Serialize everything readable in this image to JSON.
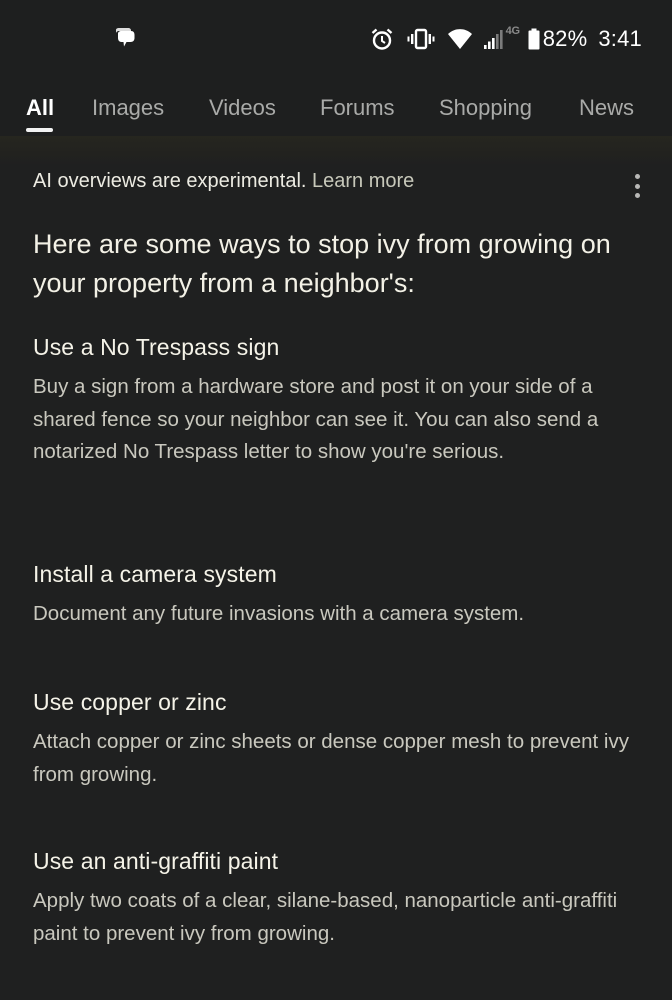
{
  "status_bar": {
    "left_icons": [
      "messages-icon"
    ],
    "right_icons": [
      "alarm-icon",
      "vibrate-icon",
      "wifi-icon",
      "signal-icon"
    ],
    "network_type": "4G",
    "battery_percent": "82%",
    "time": "3:41"
  },
  "tabs": {
    "items": [
      {
        "label": "All",
        "active": true
      },
      {
        "label": "Images",
        "active": false
      },
      {
        "label": "Videos",
        "active": false
      },
      {
        "label": "Forums",
        "active": false
      },
      {
        "label": "Shopping",
        "active": false
      },
      {
        "label": "News",
        "active": false
      }
    ]
  },
  "ai_overview": {
    "notice_text": "AI overviews are experimental.",
    "learn_more_label": "Learn more",
    "menu_icon": "more-vert-icon",
    "headline": "Here are some ways to stop ivy from growing on your property from a neighbor's:",
    "sections": [
      {
        "title": "Use a No Trespass sign",
        "body": "Buy a sign from a hardware store and post it on your side of a shared fence so your neighbor can see it. You can also send a notarized No Trespass letter to show you're serious."
      },
      {
        "title": "Install a camera system",
        "body": "Document any future invasions with a camera system."
      },
      {
        "title": "Use copper or zinc",
        "body": "Attach copper or zinc sheets or dense copper mesh to prevent ivy from growing."
      },
      {
        "title": "Use an anti-graffiti paint",
        "body": "Apply two coats of a clear, silane-based, nanoparticle anti-graffiti paint to prevent ivy from growing."
      }
    ]
  },
  "colors": {
    "background": "#1f2020",
    "text_primary": "#f3f1e6",
    "text_secondary": "#c9c8be",
    "tab_inactive": "#a9aaa8",
    "tab_active": "#ffffff"
  }
}
